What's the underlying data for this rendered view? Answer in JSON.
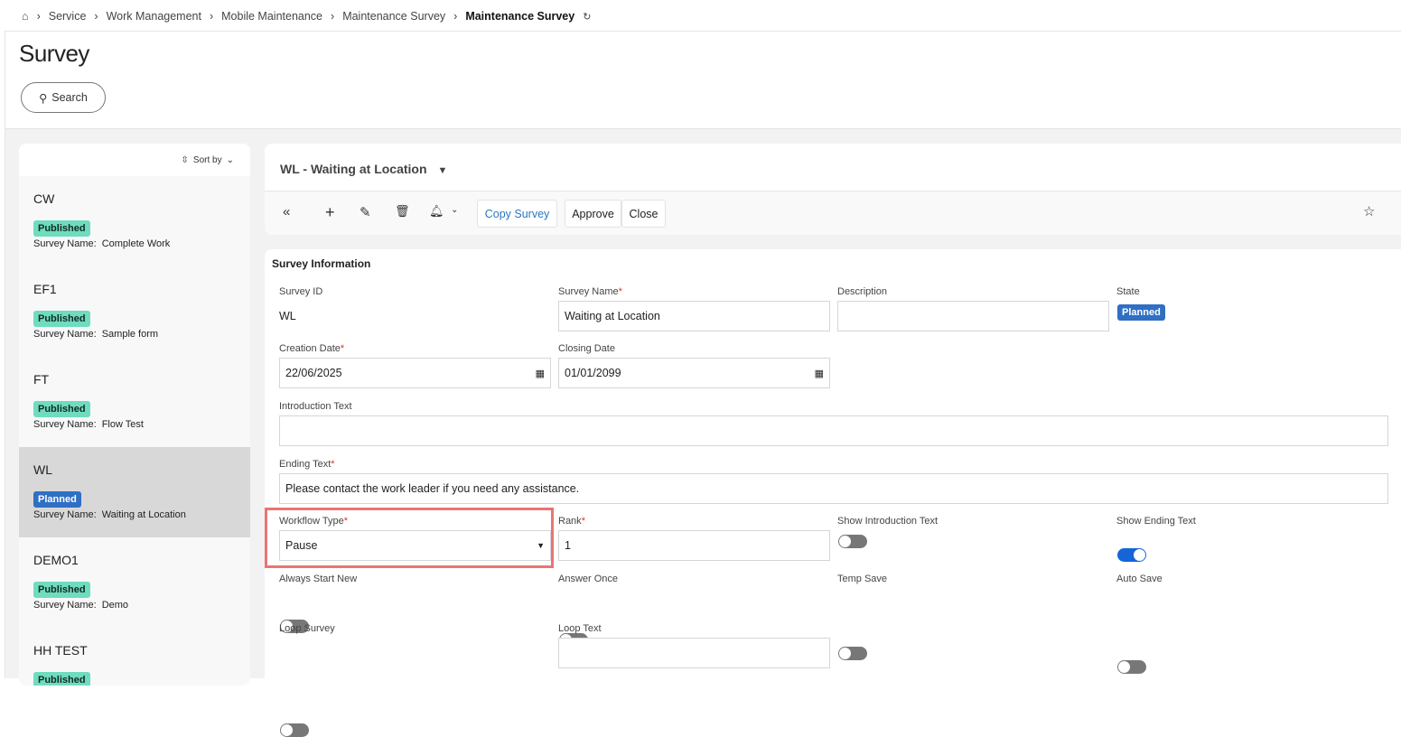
{
  "breadcrumb": {
    "items": [
      "Service",
      "Work Management",
      "Mobile Maintenance",
      "Maintenance Survey"
    ],
    "current": "Maintenance Survey"
  },
  "page_title": "Survey",
  "search_label": "Search",
  "list": {
    "sort_label": "Sort by",
    "name_label": "Survey Name:",
    "items": [
      {
        "code": "CW",
        "status": "Published",
        "name": "Complete Work"
      },
      {
        "code": "EF1",
        "status": "Published",
        "name": "Sample form"
      },
      {
        "code": "FT",
        "status": "Published",
        "name": "Flow Test"
      },
      {
        "code": "WL",
        "status": "Planned",
        "name": "Waiting at Location",
        "selected": true
      },
      {
        "code": "DEMO1",
        "status": "Published",
        "name": "Demo"
      },
      {
        "code": "HH TEST",
        "status": "Published",
        "name": ""
      }
    ]
  },
  "detail": {
    "title": "WL - Waiting at Location",
    "toolbar": {
      "copy": "Copy Survey",
      "approve": "Approve",
      "close": "Close"
    }
  },
  "form": {
    "section": "Survey Information",
    "survey_id": {
      "label": "Survey ID",
      "value": "WL"
    },
    "survey_name": {
      "label": "Survey Name",
      "value": "Waiting at Location"
    },
    "description": {
      "label": "Description",
      "value": ""
    },
    "state": {
      "label": "State",
      "value": "Planned"
    },
    "creation_date": {
      "label": "Creation Date",
      "value": "22/06/2025"
    },
    "closing_date": {
      "label": "Closing Date",
      "value": "01/01/2099"
    },
    "intro_text": {
      "label": "Introduction Text",
      "value": ""
    },
    "ending_text": {
      "label": "Ending Text",
      "value": "Please contact the work leader if you need any assistance."
    },
    "workflow_type": {
      "label": "Workflow Type",
      "value": "Pause"
    },
    "rank": {
      "label": "Rank",
      "value": "1"
    },
    "show_intro": {
      "label": "Show Introduction Text",
      "on": false
    },
    "show_ending": {
      "label": "Show Ending Text",
      "on": true
    },
    "always_start_new": {
      "label": "Always Start New",
      "on": false
    },
    "answer_once": {
      "label": "Answer Once",
      "on": false
    },
    "temp_save": {
      "label": "Temp Save",
      "on": false
    },
    "auto_save": {
      "label": "Auto Save",
      "on": false
    },
    "loop_survey": {
      "label": "Loop Survey",
      "on": false
    },
    "loop_text": {
      "label": "Loop Text",
      "value": ""
    }
  },
  "colors": {
    "published": "#6fdcbf",
    "planned": "#2f6fc4",
    "toggle_on": "#1565d8",
    "highlight": "#e87575"
  }
}
